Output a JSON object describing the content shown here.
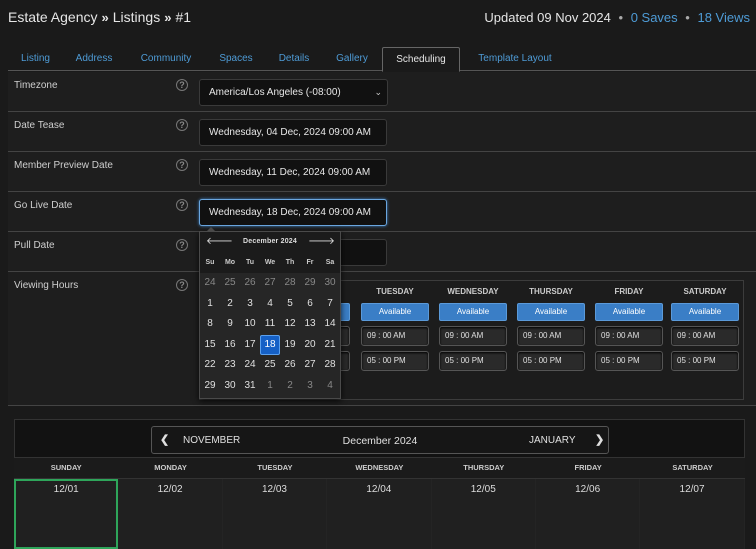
{
  "header": {
    "crumbs": [
      "Estate Agency",
      "Listings",
      "#1"
    ],
    "updated": "Updated 09 Nov 2024",
    "saves": "0 Saves",
    "views": "18 Views"
  },
  "tabs": [
    "Listing",
    "Address",
    "Community",
    "Spaces",
    "Details",
    "Gallery",
    "Scheduling",
    "Template Layout"
  ],
  "active_tab": "Scheduling",
  "form": {
    "timezone": {
      "label": "Timezone",
      "value": "America/Los Angeles (-08:00)"
    },
    "date_tease": {
      "label": "Date Tease",
      "value": "Wednesday, 04 Dec, 2024 09:00 AM"
    },
    "member_preview": {
      "label": "Member Preview Date",
      "value": "Wednesday, 11 Dec, 2024 09:00 AM"
    },
    "go_live": {
      "label": "Go Live Date",
      "value": "Wednesday, 18 Dec, 2024 09:00 AM"
    },
    "pull_date": {
      "label": "Pull Date",
      "value": ""
    },
    "viewing_hours": {
      "label": "Viewing Hours"
    }
  },
  "help_glyph": "?",
  "hours": {
    "days": [
      "Tuesday",
      "Wednesday",
      "Thursday",
      "Friday",
      "Saturday"
    ],
    "available_label": "Available",
    "open": "09 : 00  AM",
    "close": "05 : 00  PM"
  },
  "picker": {
    "month": "December 2024",
    "prev": "🡐",
    "next": "🡒",
    "dows": [
      "Su",
      "Mo",
      "Tu",
      "We",
      "Th",
      "Fr",
      "Sa"
    ],
    "weeks": [
      [
        "24",
        "25",
        "26",
        "27",
        "28",
        "29",
        "30"
      ],
      [
        "1",
        "2",
        "3",
        "4",
        "5",
        "6",
        "7"
      ],
      [
        "8",
        "9",
        "10",
        "11",
        "12",
        "13",
        "14"
      ],
      [
        "15",
        "16",
        "17",
        "18",
        "19",
        "20",
        "21"
      ],
      [
        "22",
        "23",
        "24",
        "25",
        "26",
        "27",
        "28"
      ],
      [
        "29",
        "30",
        "31",
        "1",
        "2",
        "3",
        "4"
      ]
    ],
    "selected": "18"
  },
  "calendar": {
    "prev_month": "November",
    "current": "December 2024",
    "next_month": "January",
    "prev_glyph": "❮",
    "next_glyph": "❯",
    "days": [
      "Sunday",
      "Monday",
      "Tuesday",
      "Wednesday",
      "Thursday",
      "Friday",
      "Saturday"
    ],
    "dates": [
      "12/01",
      "12/02",
      "12/03",
      "12/04",
      "12/05",
      "12/06",
      "12/07"
    ]
  },
  "colors": {
    "accent": "#4e9bd6",
    "available": "#3a7ec6",
    "selected_day": "#1560c6",
    "today_border": "#2ea55a"
  }
}
